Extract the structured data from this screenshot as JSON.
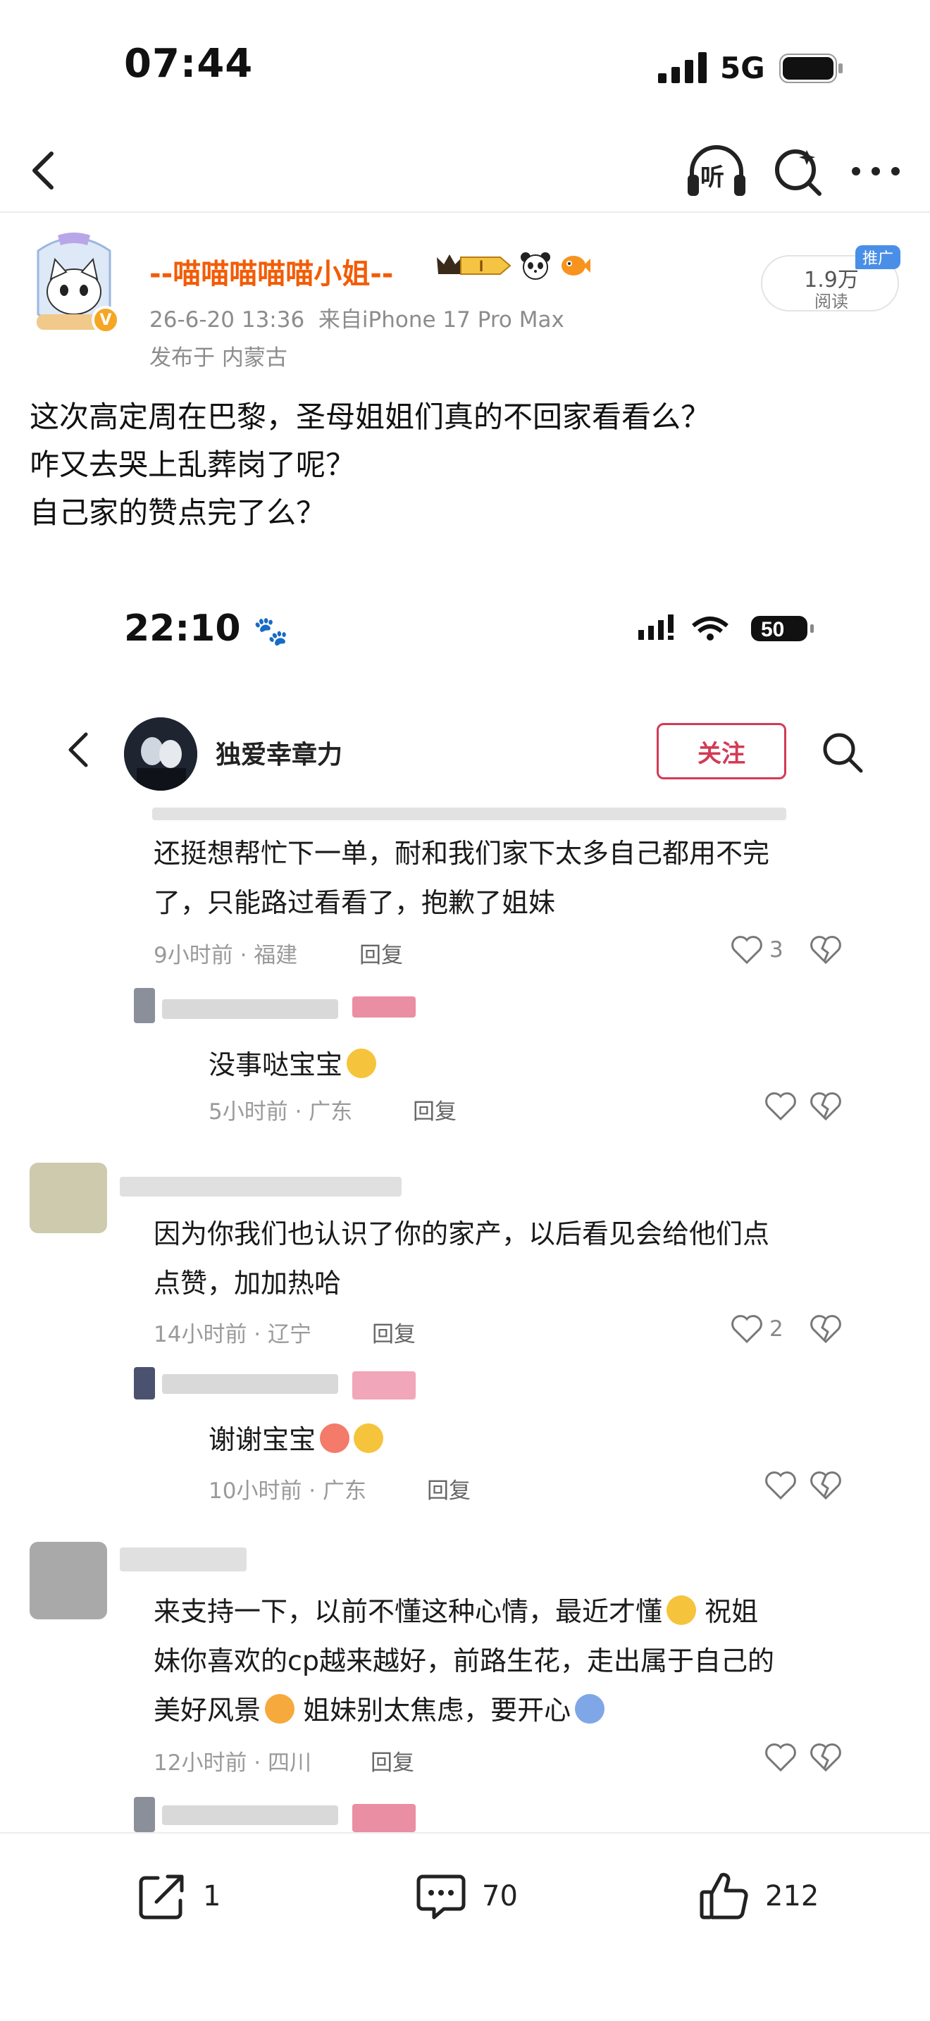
{
  "status_bar": {
    "time": "07:44",
    "network": "5G"
  },
  "nav": {
    "back_icon": "chevron-left-icon",
    "listen_label": "听",
    "search_icon": "search-icon",
    "more_icon": "more-icon"
  },
  "author": {
    "name": "--喵喵喵喵喵小姐--",
    "verified_badge": "V",
    "timestamp": "26-6-20 13:36",
    "source": "来自iPhone 17 Pro Max",
    "location": "发布于 内蒙古",
    "badge_level": "I"
  },
  "reads": {
    "count": "1.9万",
    "label": "阅读",
    "promo_tag": "推广"
  },
  "post": {
    "lines": [
      "这次高定周在巴黎，圣母姐姐们真的不回家看看么？",
      "咋又去哭上乱葬岗了呢？",
      "自己家的赞点完了么？"
    ]
  },
  "screenshot": {
    "time": "22:10",
    "battery": "50",
    "profile_name": "独爱幸章力",
    "follow_label": "关注",
    "comments": [
      {
        "lines": [
          "还挺想帮忙下一单，耐和我们家下太多自己都用不完",
          "了，只能路过看看了，抱歉了姐妹"
        ],
        "meta": "9小时前 · 福建",
        "reply": "回复",
        "likes": "3"
      },
      {
        "lines": [
          "没事哒宝宝"
        ],
        "meta": "5小时前 · 广东",
        "reply": "回复",
        "likes": ""
      },
      {
        "lines": [
          "因为你我们也认识了你的家产，以后看见会给他们点",
          "点赞，加加热哈"
        ],
        "meta": "14小时前 · 辽宁",
        "reply": "回复",
        "likes": "2"
      },
      {
        "lines": [
          "谢谢宝宝"
        ],
        "meta": "10小时前 · 广东",
        "reply": "回复",
        "likes": ""
      },
      {
        "lines": [
          "来支持一下，以前不懂这种心情，最近才懂",
          "祝姐",
          "妹你喜欢的cp越来越好，前路生花，走出属于自己的",
          "美好风景",
          "姐妹别太焦虑，要开心"
        ],
        "meta": "12小时前 · 四川",
        "reply": "回复",
        "likes": ""
      }
    ]
  },
  "toolbar": {
    "share_count": "1",
    "comment_count": "70",
    "like_count": "212"
  },
  "colors": {
    "username": "#f25c05",
    "follow": "#d23b55",
    "promo": "#4a8fe7"
  }
}
